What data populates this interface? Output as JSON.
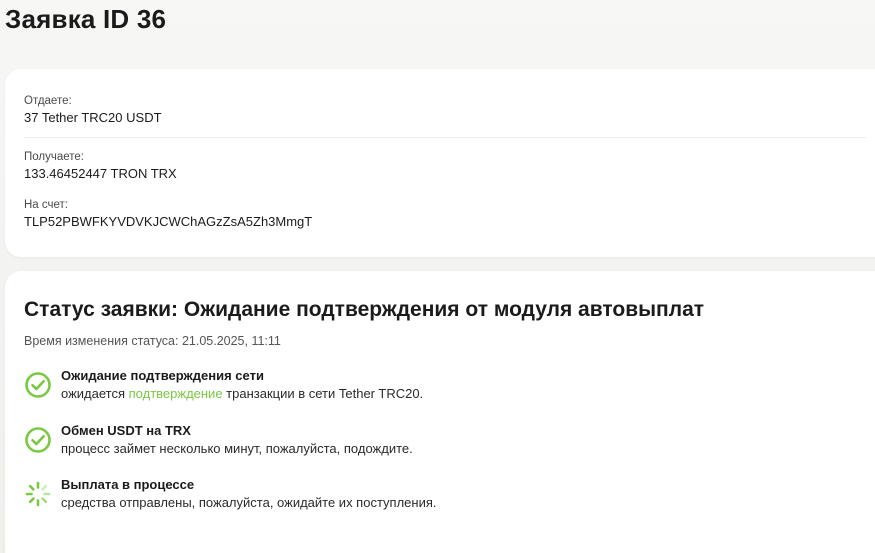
{
  "page": {
    "title": "Заявка ID 36"
  },
  "details": {
    "give_label": "Отдаете:",
    "give_value": "37 Tether TRC20 USDT",
    "receive_label": "Получаете:",
    "receive_value": "133.46452447 TRON TRX",
    "account_label": "На счет:",
    "account_value": "TLP52PBWFKYVDVKJCWChAGzZsA5Zh3MmgT"
  },
  "status": {
    "title": "Статус заявки: Ожидание подтверждения от модуля автовыплат",
    "time_text": "Время изменения статуса: 21.05.2025, 11:11",
    "steps": [
      {
        "title": "Ожидание подтверждения сети",
        "desc_before": "ожидается ",
        "desc_link": "подтверждение",
        "desc_after": " транзакции в сети Tether TRC20.",
        "state": "done",
        "icon": "check-circle-icon"
      },
      {
        "title": "Обмен USDT на TRX",
        "desc": "процесс займет несколько минут, пожалуйста, подождите.",
        "state": "done",
        "icon": "check-circle-icon"
      },
      {
        "title": "Выплата в процессе",
        "desc": "средства отправлены, пожалуйста, ожидайте их поступления.",
        "state": "in-progress",
        "icon": "spinner-icon"
      }
    ]
  },
  "colors": {
    "accent": "#7ac943",
    "text": "#1b1b1b",
    "card_bg": "#ffffff"
  }
}
